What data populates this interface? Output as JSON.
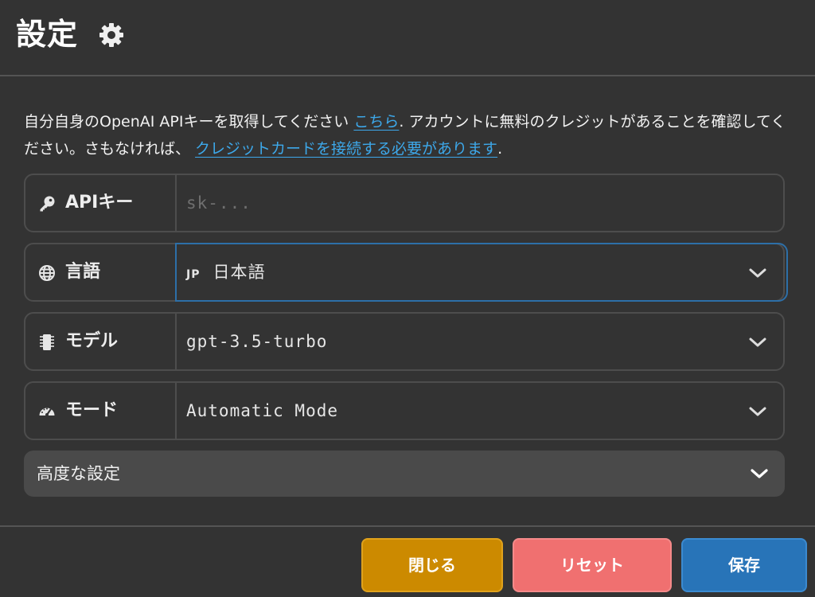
{
  "header": {
    "title": "設定"
  },
  "intro": {
    "text_1": "自分自身のOpenAI APIキーを取得してください ",
    "link_1": "こちら",
    "text_2": ". アカウントに無料のクレジットがあることを確認してください。さもなければ、 ",
    "link_2": "クレジットカードを接続する必要があります",
    "text_3": "."
  },
  "fields": {
    "api_key": {
      "label": "APIキー",
      "value": "",
      "placeholder": "sk-..."
    },
    "language": {
      "label": "言語",
      "flag": "JP",
      "value": "日本語"
    },
    "model": {
      "label": "モデル",
      "value": "gpt-3.5-turbo"
    },
    "mode": {
      "label": "モード",
      "value": "Automatic Mode"
    }
  },
  "advanced": {
    "label": "高度な設定"
  },
  "buttons": {
    "close": "閉じる",
    "reset": "リセット",
    "save": "保存"
  },
  "icons": {
    "title": "gear-icon",
    "api_key": "key-icon",
    "language": "globe-icon",
    "model": "chip-icon",
    "mode": "speedometer-icon",
    "dropdown": "chevron-down-icon"
  },
  "colors": {
    "background": "#333333",
    "link": "#3da8ea",
    "focus_border": "#2d6fa8",
    "close_button": "#cc8a00",
    "reset_button": "#f07070",
    "save_button": "#2874b8"
  }
}
